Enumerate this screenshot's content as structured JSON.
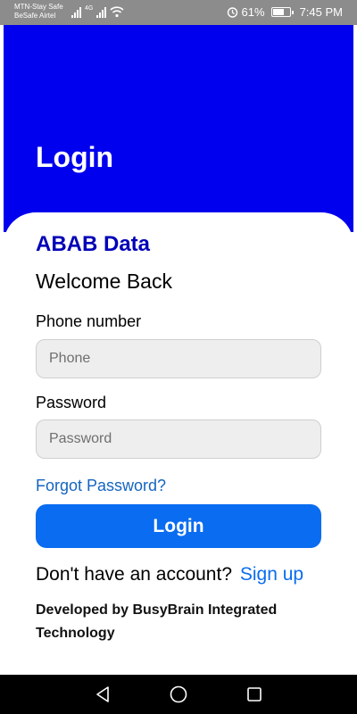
{
  "status_bar": {
    "carrier_1": "MTN-Stay Safe",
    "carrier_2": "BeSafe Airtel",
    "network_type": "4G",
    "battery_percent": "61%",
    "battery_level": 0.61,
    "time": "7:45 PM",
    "icons": [
      "signal-icon",
      "wifi-icon",
      "alarm-icon",
      "battery-icon"
    ]
  },
  "header": {
    "title": "Login",
    "background_color": "#0000ee"
  },
  "form": {
    "brand": "ABAB Data",
    "welcome": "Welcome Back",
    "phone_label": "Phone number",
    "phone_placeholder": "Phone",
    "phone_value": "",
    "password_label": "Password",
    "password_placeholder": "Password",
    "password_value": "",
    "forgot_password": "Forgot Password?",
    "login_button": "Login",
    "signup_prompt": "Don't have an account?",
    "signup_link": "Sign up",
    "footer": "Developed by BusyBrain Integrated Technology"
  },
  "nav_bar": {
    "icons": [
      "back-icon",
      "home-icon",
      "recent-apps-icon"
    ]
  },
  "colors": {
    "accent": "#0a6cf0",
    "brand_text": "#0000b8",
    "link": "#1565c0"
  }
}
